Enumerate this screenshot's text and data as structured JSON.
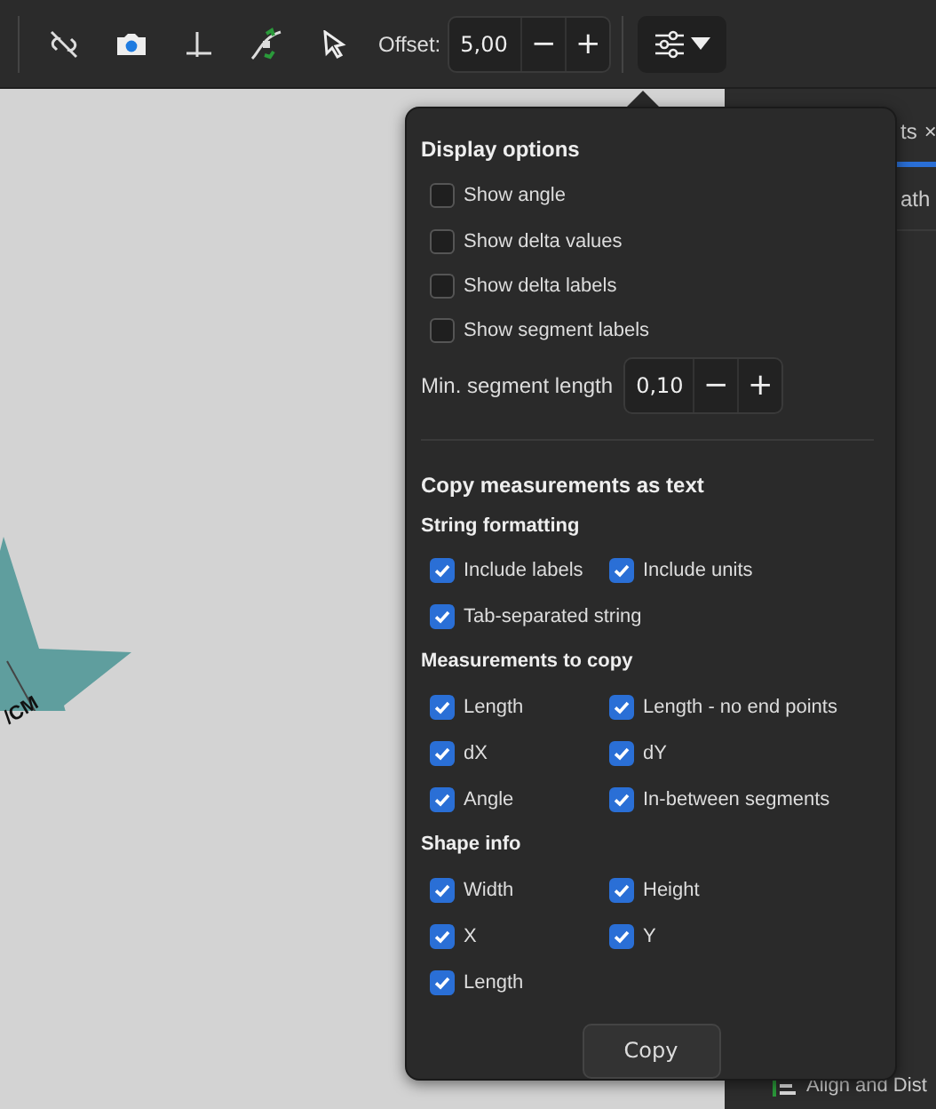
{
  "toolbar": {
    "offset_label": "Offset:",
    "offset_value": "5,00",
    "minus": "−",
    "plus": "+"
  },
  "canvas": {
    "label": "/CM"
  },
  "side_panel": {
    "tab": "ts",
    "tab_close": "×",
    "row": "ath",
    "bottom": "Align and Dist"
  },
  "popover": {
    "display": {
      "title": "Display options",
      "options": [
        {
          "label": "Show angle",
          "checked": false
        },
        {
          "label": "Show delta values",
          "checked": false
        },
        {
          "label": "Show delta labels",
          "checked": false
        },
        {
          "label": "Show segment labels",
          "checked": false
        }
      ],
      "min_label": "Min. segment length",
      "min_value": "0,10",
      "minus": "−",
      "plus": "+"
    },
    "copy": {
      "title": "Copy measurements as text",
      "groups": [
        {
          "title": "String formatting",
          "items": [
            {
              "label": "Include labels",
              "checked": true
            },
            {
              "label": "Include units",
              "checked": true
            },
            {
              "label": "Tab-separated string",
              "checked": true
            }
          ]
        },
        {
          "title": "Measurements to copy",
          "items": [
            {
              "label": "Length",
              "checked": true
            },
            {
              "label": "Length - no end points",
              "checked": true
            },
            {
              "label": "dX",
              "checked": true
            },
            {
              "label": "dY",
              "checked": true
            },
            {
              "label": "Angle",
              "checked": true
            },
            {
              "label": "In-between segments",
              "checked": true
            }
          ]
        },
        {
          "title": "Shape info",
          "items": [
            {
              "label": "Width",
              "checked": true
            },
            {
              "label": "Height",
              "checked": true
            },
            {
              "label": "X",
              "checked": true
            },
            {
              "label": "Y",
              "checked": true
            },
            {
              "label": "Length",
              "checked": true
            }
          ]
        }
      ],
      "button": "Copy"
    }
  }
}
